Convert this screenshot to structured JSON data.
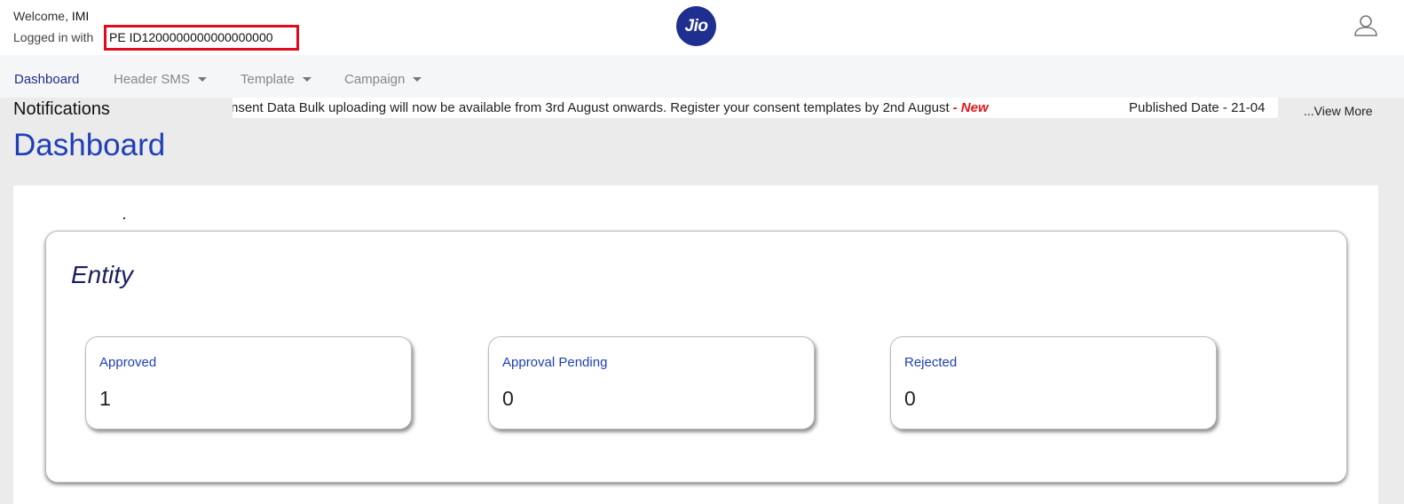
{
  "header": {
    "welcome_prefix": "Welcome,",
    "username": "IMI",
    "logged_in_prefix": "Logged in with",
    "pe_label": "PE ID",
    "pe_id": "1200000000000000000",
    "logo_text": "Jio",
    "profile_icon": "user-icon"
  },
  "nav": {
    "items": [
      {
        "label": "Dashboard",
        "dropdown": false,
        "active": true
      },
      {
        "label": "Header SMS",
        "dropdown": true,
        "active": false
      },
      {
        "label": "Template",
        "dropdown": true,
        "active": false
      },
      {
        "label": "Campaign",
        "dropdown": true,
        "active": false
      }
    ]
  },
  "notifications": {
    "title": "Notifications",
    "message": "nsent Data Bulk uploading will now be available from 3rd August onwards. Register your consent templates by 2nd August",
    "new_tag": "- New",
    "published": "Published Date - 21-04",
    "view_more": "...View More"
  },
  "page": {
    "title": "Dashboard"
  },
  "entity": {
    "title": "Entity",
    "cards": [
      {
        "label": "Approved",
        "value": "1"
      },
      {
        "label": "Approval Pending",
        "value": "0"
      },
      {
        "label": "Rejected",
        "value": "0"
      }
    ]
  },
  "colors": {
    "brand": "#1f2f8f",
    "accent": "#1f3fb5",
    "highlight_border": "#e00b1c",
    "new_tag": "#e0161b"
  }
}
